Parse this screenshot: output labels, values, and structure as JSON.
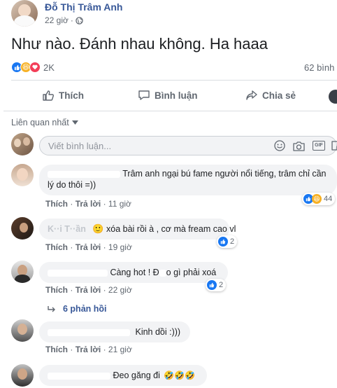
{
  "post": {
    "author": "Đỗ Thị Trâm Anh",
    "time": "22 giờ",
    "text": "Như nào. Đánh nhau không. Ha haaa",
    "reaction_count": "2K",
    "comment_count": "62 bình"
  },
  "actions": {
    "like": "Thích",
    "comment": "Bình luận",
    "share": "Chia sẻ"
  },
  "sort": {
    "label": "Liên quan nhất"
  },
  "composer": {
    "placeholder": "Viết bình luận..."
  },
  "comment_actions": {
    "like": "Thích",
    "reply": "Trả lời"
  },
  "comments": [
    {
      "author_visible": "",
      "text": "Trâm anh ngại bú fame người nổi tiếng, trâm chỉ cần lý do thôi =))",
      "time": "11 giờ",
      "reactions": "44"
    },
    {
      "author_visible": "K··i T··ần",
      "text": "xóa bài rồi à , cơ mà fream cao vl",
      "time": "19 giờ",
      "reactions": "2"
    },
    {
      "author_visible": "",
      "text_a": "Càng hot ! Đ",
      "text_b": "o gì phải xoá",
      "time": "22 giờ",
      "reactions": "2"
    },
    {
      "author_visible": "",
      "text": "Kinh dồi :)))",
      "time": "21 giờ"
    },
    {
      "author_visible": "",
      "text": "Đeo găng đi",
      "time": ""
    }
  ],
  "replies": {
    "label": "6 phản hồi"
  },
  "colors": {
    "accent": "#1877f2",
    "muted": "#606770",
    "bubble": "#f2f3f5"
  }
}
